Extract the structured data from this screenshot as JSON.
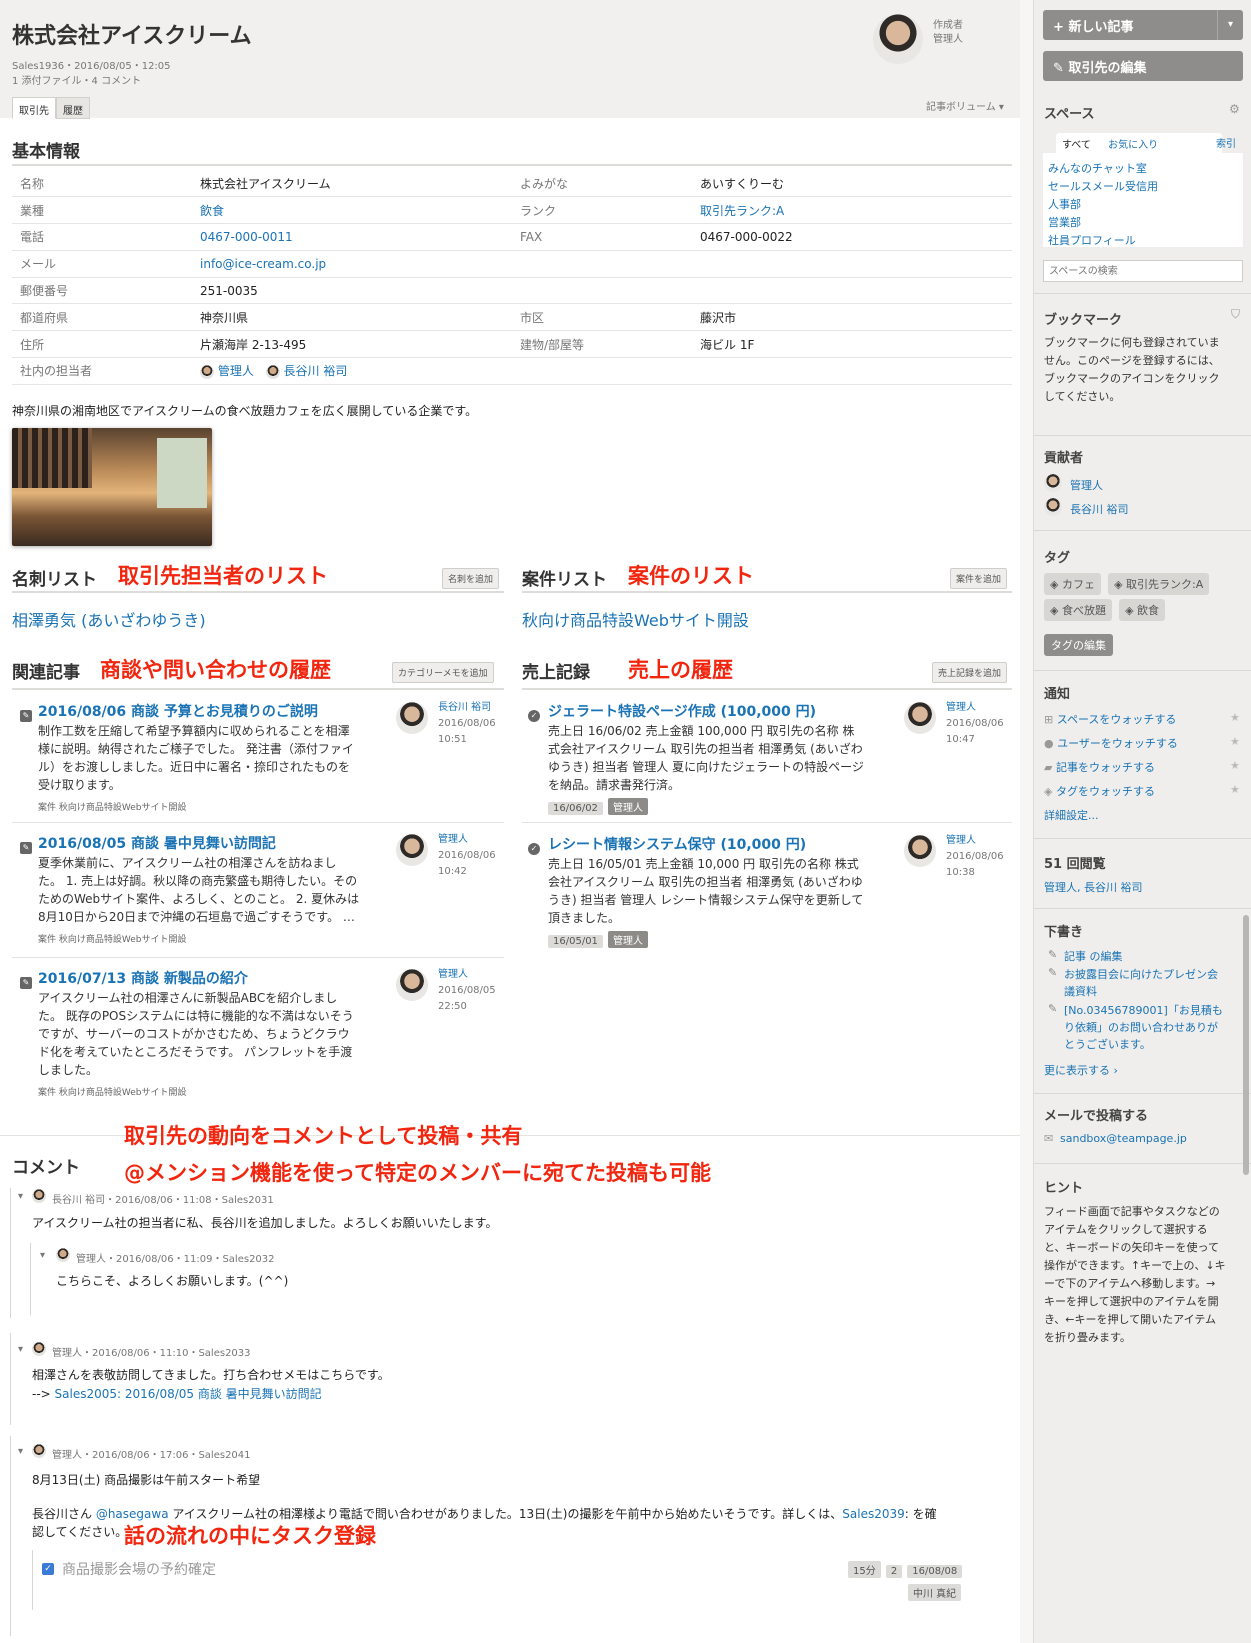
{
  "header": {
    "title": "株式会社アイスクリーム",
    "meta_line1": "Sales1936・2016/08/05・12:05",
    "meta_line2": "1 添付ファイル・4 コメント",
    "author_label": "作成者",
    "author_name": "管理人",
    "tabs": [
      {
        "label": "取引先"
      },
      {
        "label": "履歴"
      }
    ],
    "volume_label": "記事ボリューム"
  },
  "basic": {
    "title": "基本情報",
    "rows": [
      {
        "l1": "名称",
        "v1": "株式会社アイスクリーム",
        "l2": "よみがな",
        "v2": "あいすくりーむ"
      },
      {
        "l1": "業種",
        "v1": "飲食",
        "l2": "ランク",
        "v2": "取引先ランク:A"
      },
      {
        "l1": "電話",
        "v1": "0467-000-0011",
        "l2": "FAX",
        "v2": "0467-000-0022"
      },
      {
        "l1": "メール",
        "v1": "info@ice-cream.co.jp",
        "l2": "",
        "v2": ""
      },
      {
        "l1": "郵便番号",
        "v1": "251-0035",
        "l2": "",
        "v2": ""
      },
      {
        "l1": "都道府県",
        "v1": "神奈川県",
        "l2": "市区",
        "v2": "藤沢市"
      },
      {
        "l1": "住所",
        "v1": "片瀬海岸 2-13-495",
        "l2": "建物/部屋等",
        "v2": "海ビル 1F"
      },
      {
        "l1": "社内の担当者",
        "v1a": "管理人",
        "v1b": "長谷川 裕司",
        "l2": "",
        "v2": ""
      }
    ],
    "description": "神奈川県の湘南地区でアイスクリームの食べ放題カフェを広く展開している企業です。"
  },
  "cards": {
    "title": "名刺リスト",
    "annotation": "取引先担当者のリスト",
    "button": "名刺を追加",
    "item": "相澤勇気 (あいざわゆうき)"
  },
  "projects": {
    "title": "案件リスト",
    "annotation": "案件のリスト",
    "button": "案件を追加",
    "item": "秋向け商品特設Webサイト開設"
  },
  "related": {
    "title": "関連記事",
    "annotation": "商談や問い合わせの履歴",
    "button": "カテゴリーメモを追加",
    "items": [
      {
        "title": "2016/08/06 商談 予算とお見積りのご説明",
        "body": [
          "制作工数を圧縮して希望予算額内に収められることを相澤",
          "様に説明。納得されたご様子でした。 発注書（添付ファイ",
          "ル）をお渡ししました。近日中に署名・捺印されたものを",
          "受け取ります。"
        ],
        "foot": "案件 秋向け商品特設Webサイト開設",
        "author": "長谷川 裕司",
        "date": "2016/08/06",
        "time": "10:51"
      },
      {
        "title": "2016/08/05 商談 暑中見舞い訪問記",
        "body": [
          "夏季休業前に、アイスクリーム社の相澤さんを訪ねまし",
          "た。 1. 売上は好調。秋以降の商売繁盛も期待したい。その",
          "ためのWebサイト案件、よろしく、とのこと。 2. 夏休みは",
          "8月10日から20日まで沖縄の石垣島で過ごすそうです。 …"
        ],
        "foot": "案件 秋向け商品特設Webサイト開設",
        "author": "管理人",
        "date": "2016/08/06",
        "time": "10:42"
      },
      {
        "title": "2016/07/13 商談 新製品の紹介",
        "body": [
          "アイスクリーム社の相澤さんに新製品ABCを紹介しまし",
          "た。 既存のPOSシステムには特に機能的な不満はないそう",
          "ですが、サーバーのコストがかさむため、ちょうどクラウ",
          "ド化を考えていたところだそうです。 パンフレットを手渡",
          "しました。"
        ],
        "foot": "案件 秋向け商品特設Webサイト開設",
        "author": "管理人",
        "date": "2016/08/05",
        "time": "22:50"
      }
    ]
  },
  "sales": {
    "title": "売上記録",
    "annotation": "売上の履歴",
    "button": "売上記録を追加",
    "items": [
      {
        "title": "ジェラート特設ページ作成 (100,000 円)",
        "body": [
          "売上日 16/06/02 売上金額 100,000 円 取引先の名称 株",
          "式会社アイスクリーム 取引先の担当者 相澤勇気 (あいざわ",
          "ゆうき) 担当者 管理人 夏に向けたジェラートの特設ページ",
          "を納品。請求書発行済。"
        ],
        "tag_date": "16/06/02",
        "tag_user": "管理人",
        "author": "管理人",
        "date": "2016/08/06",
        "time": "10:47"
      },
      {
        "title": "レシート情報システム保守 (10,000 円)",
        "body": [
          "売上日 16/05/01 売上金額 10,000 円 取引先の名称 株式",
          "会社アイスクリーム 取引先の担当者 相澤勇気 (あいざわゆ",
          "うき) 担当者 管理人 レシート情報システム保守を更新して",
          "頂きました。"
        ],
        "tag_date": "16/05/01",
        "tag_user": "管理人",
        "author": "管理人",
        "date": "2016/08/06",
        "time": "10:38"
      }
    ]
  },
  "comments": {
    "title": "コメント",
    "annotation1": "取引先の動向をコメントとして投稿・共有",
    "annotation2": "@メンション機能を使って特定のメンバーに宛てた投稿も可能",
    "annotation3": "話の流れの中にタスク登録",
    "c1_head": "長谷川 裕司・2016/08/06・11:08・Sales2031",
    "c1_body": "アイスクリーム社の担当者に私、長谷川を追加しました。よろしくお願いいたします。",
    "c2_head": "管理人・2016/08/06・11:09・Sales2032",
    "c2_body": "こちらこそ、よろしくお願いします。(^^)",
    "c3_head": "管理人・2016/08/06・11:10・Sales2033",
    "c3_body": "相澤さんを表敬訪問してきました。打ち合わせメモはこちらです。",
    "c3_link_prefix": "--> ",
    "c3_link": "Sales2005: 2016/08/05 商談 暑中見舞い訪問記",
    "c4_head": "管理人・2016/08/06・17:06・Sales2041",
    "c4_subtitle": "8月13日(土) 商品撮影は午前スタート希望",
    "c4_body_pre": "長谷川さん ",
    "c4_mention": "@hasegawa",
    "c4_body_mid": " アイスクリーム社の相澤様より電話で問い合わせがありました。13日(土)の撮影を午前中から始めたいそうです。詳しくは、",
    "c4_link": "Sales2039",
    "c4_body_post": ": を確",
    "c4_body_line2": "認してください。",
    "task_label": "商品撮影会場の予約確定",
    "task_time": "15分",
    "task_count": "2",
    "task_date": "16/08/08",
    "task_user": "中川 真紀"
  },
  "sidebar": {
    "new_button": "新しい記事",
    "edit_button": "取引先の編集",
    "space_title": "スペース",
    "space_tabs": [
      "すべて",
      "お気に入り",
      "索引"
    ],
    "spaces": [
      "みんなのチャット室",
      "セールスメール受信用",
      "人事部",
      "営業部",
      "社員プロフィール"
    ],
    "space_search_placeholder": "スペースの検索",
    "bookmark_title": "ブックマーク",
    "bookmark_text": [
      "ブックマークに何も登録されていま",
      "せん。このページを登録するには、",
      "ブックマークのアイコンをクリック",
      "してください。"
    ],
    "contrib_title": "貢献者",
    "contributors": [
      "管理人",
      "長谷川 裕司"
    ],
    "tag_title": "タグ",
    "tags": [
      "カフェ",
      "取引先ランク:A",
      "食べ放題",
      "飲食"
    ],
    "tag_edit": "タグの編集",
    "notify_title": "通知",
    "notify_items": [
      "スペースをウォッチする",
      "ユーザーをウォッチする",
      "記事をウォッチする",
      "タグをウォッチする"
    ],
    "notify_more": "詳細設定...",
    "views_title": "51 回閲覧",
    "views_users": "管理人, 長谷川 裕司",
    "draft_title": "下書き",
    "drafts": [
      [
        "記事 の編集"
      ],
      [
        "お披露目会に向けたプレゼン会",
        "議資料"
      ],
      [
        "[No.03456789001]「お見積も",
        "り依頼」のお問い合わせありが",
        "とうございます。"
      ]
    ],
    "draft_more": "更に表示する ›",
    "mail_title": "メールで投稿する",
    "mail_addr": "sandbox@teampage.jp",
    "hint_title": "ヒント",
    "hint_text": [
      "フィード画面で記事やタスクなどの",
      "アイテムをクリックして選択する",
      "と、キーボードの矢印キーを使って",
      "操作ができます。↑キーで上の、↓キ",
      "ーで下のアイテムへ移動します。→",
      "キーを押して選択中のアイテムを開",
      "き、←キーを押して開いたアイテム",
      "を折り畳みます。"
    ]
  }
}
